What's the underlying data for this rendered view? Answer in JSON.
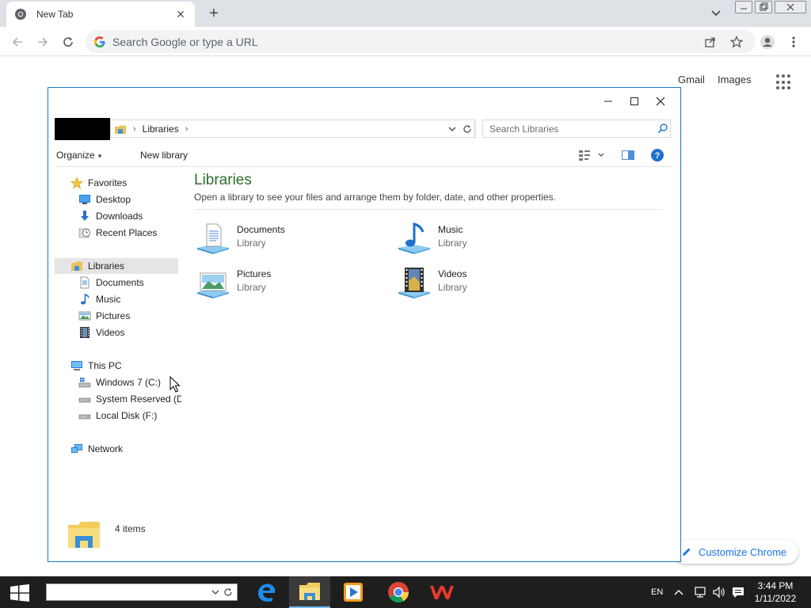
{
  "chrome": {
    "tab_title": "New Tab",
    "new_tab_symbol": "+",
    "tab_close_symbol": "✕",
    "omnibox_placeholder": "Search Google or type a URL",
    "ntp_links": [
      "Gmail",
      "Images"
    ],
    "customize_label": "Customize Chrome",
    "accent": "#1a73e8"
  },
  "explorer": {
    "breadcrumb": "Libraries",
    "search_placeholder": "Search Libraries",
    "commands": {
      "organize": "Organize",
      "new_library": "New library"
    },
    "nav": {
      "favorites": "Favorites",
      "favorites_items": [
        "Desktop",
        "Downloads",
        "Recent Places"
      ],
      "libraries": "Libraries",
      "libraries_items": [
        "Documents",
        "Music",
        "Pictures",
        "Videos"
      ],
      "this_pc": "This PC",
      "this_pc_items": [
        "Windows 7 (C:)",
        "System Reserved (D:",
        "Local Disk (F:)"
      ],
      "network": "Network"
    },
    "content": {
      "title": "Libraries",
      "subtitle": "Open a library to see your files and arrange them by folder, date, and other properties.",
      "items": [
        {
          "name": "Documents",
          "type": "Library",
          "icon": "documents-library-icon"
        },
        {
          "name": "Music",
          "type": "Library",
          "icon": "music-library-icon"
        },
        {
          "name": "Pictures",
          "type": "Library",
          "icon": "pictures-library-icon"
        },
        {
          "name": "Videos",
          "type": "Library",
          "icon": "videos-library-icon"
        }
      ]
    },
    "status": "4 items",
    "window_border_color": "#1979ca"
  },
  "taskbar": {
    "language": "EN",
    "time": "3:44 PM",
    "date": "1/11/2022",
    "apps": [
      "edge-icon",
      "file-explorer-icon",
      "media-player-icon",
      "chrome-icon",
      "wps-office-icon"
    ]
  }
}
